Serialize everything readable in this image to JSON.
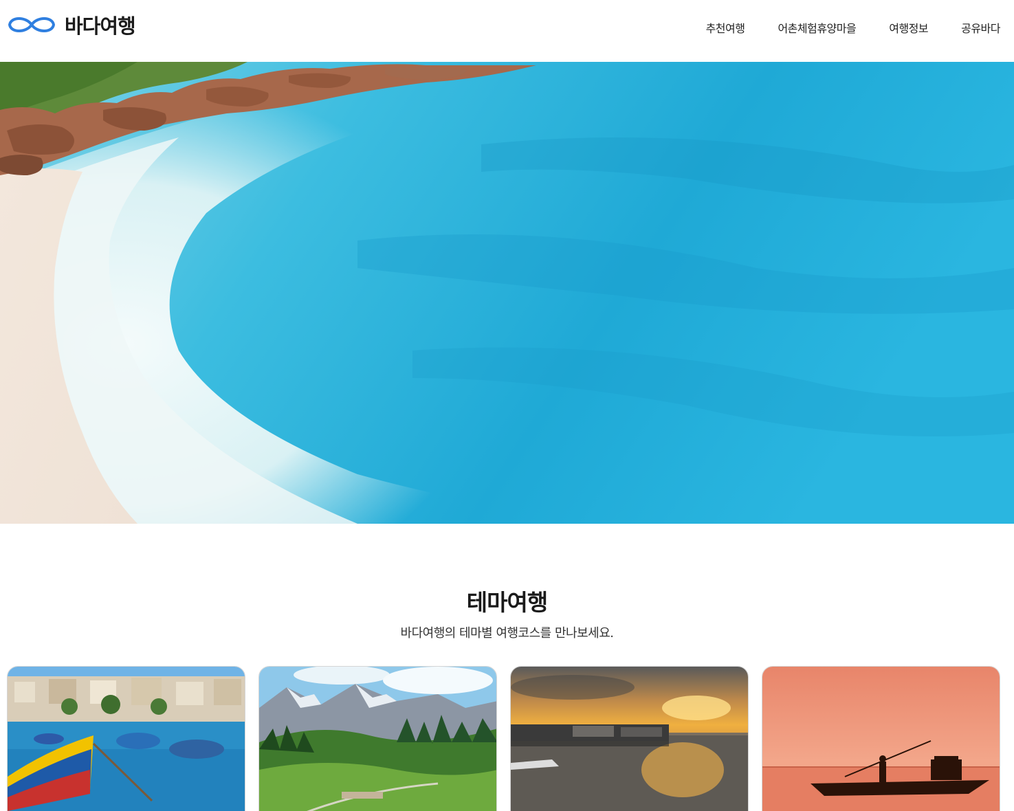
{
  "header": {
    "logo_text": "바다여행",
    "nav": [
      {
        "label": "추천여행"
      },
      {
        "label": "어촌체험휴양마을"
      },
      {
        "label": "여행정보"
      },
      {
        "label": "공유바다"
      }
    ]
  },
  "theme": {
    "title": "테마여행",
    "subtitle": "바다여행의 테마별 여행코스를 만나보세요."
  },
  "colors": {
    "brand_blue": "#2f7fe0",
    "sea": "#2bb4e0"
  },
  "cards": [
    {
      "icon": "harbor-boats-photo"
    },
    {
      "icon": "mountain-meadow-photo"
    },
    {
      "icon": "sunset-pier-photo"
    },
    {
      "icon": "fisherman-boat-photo"
    }
  ]
}
